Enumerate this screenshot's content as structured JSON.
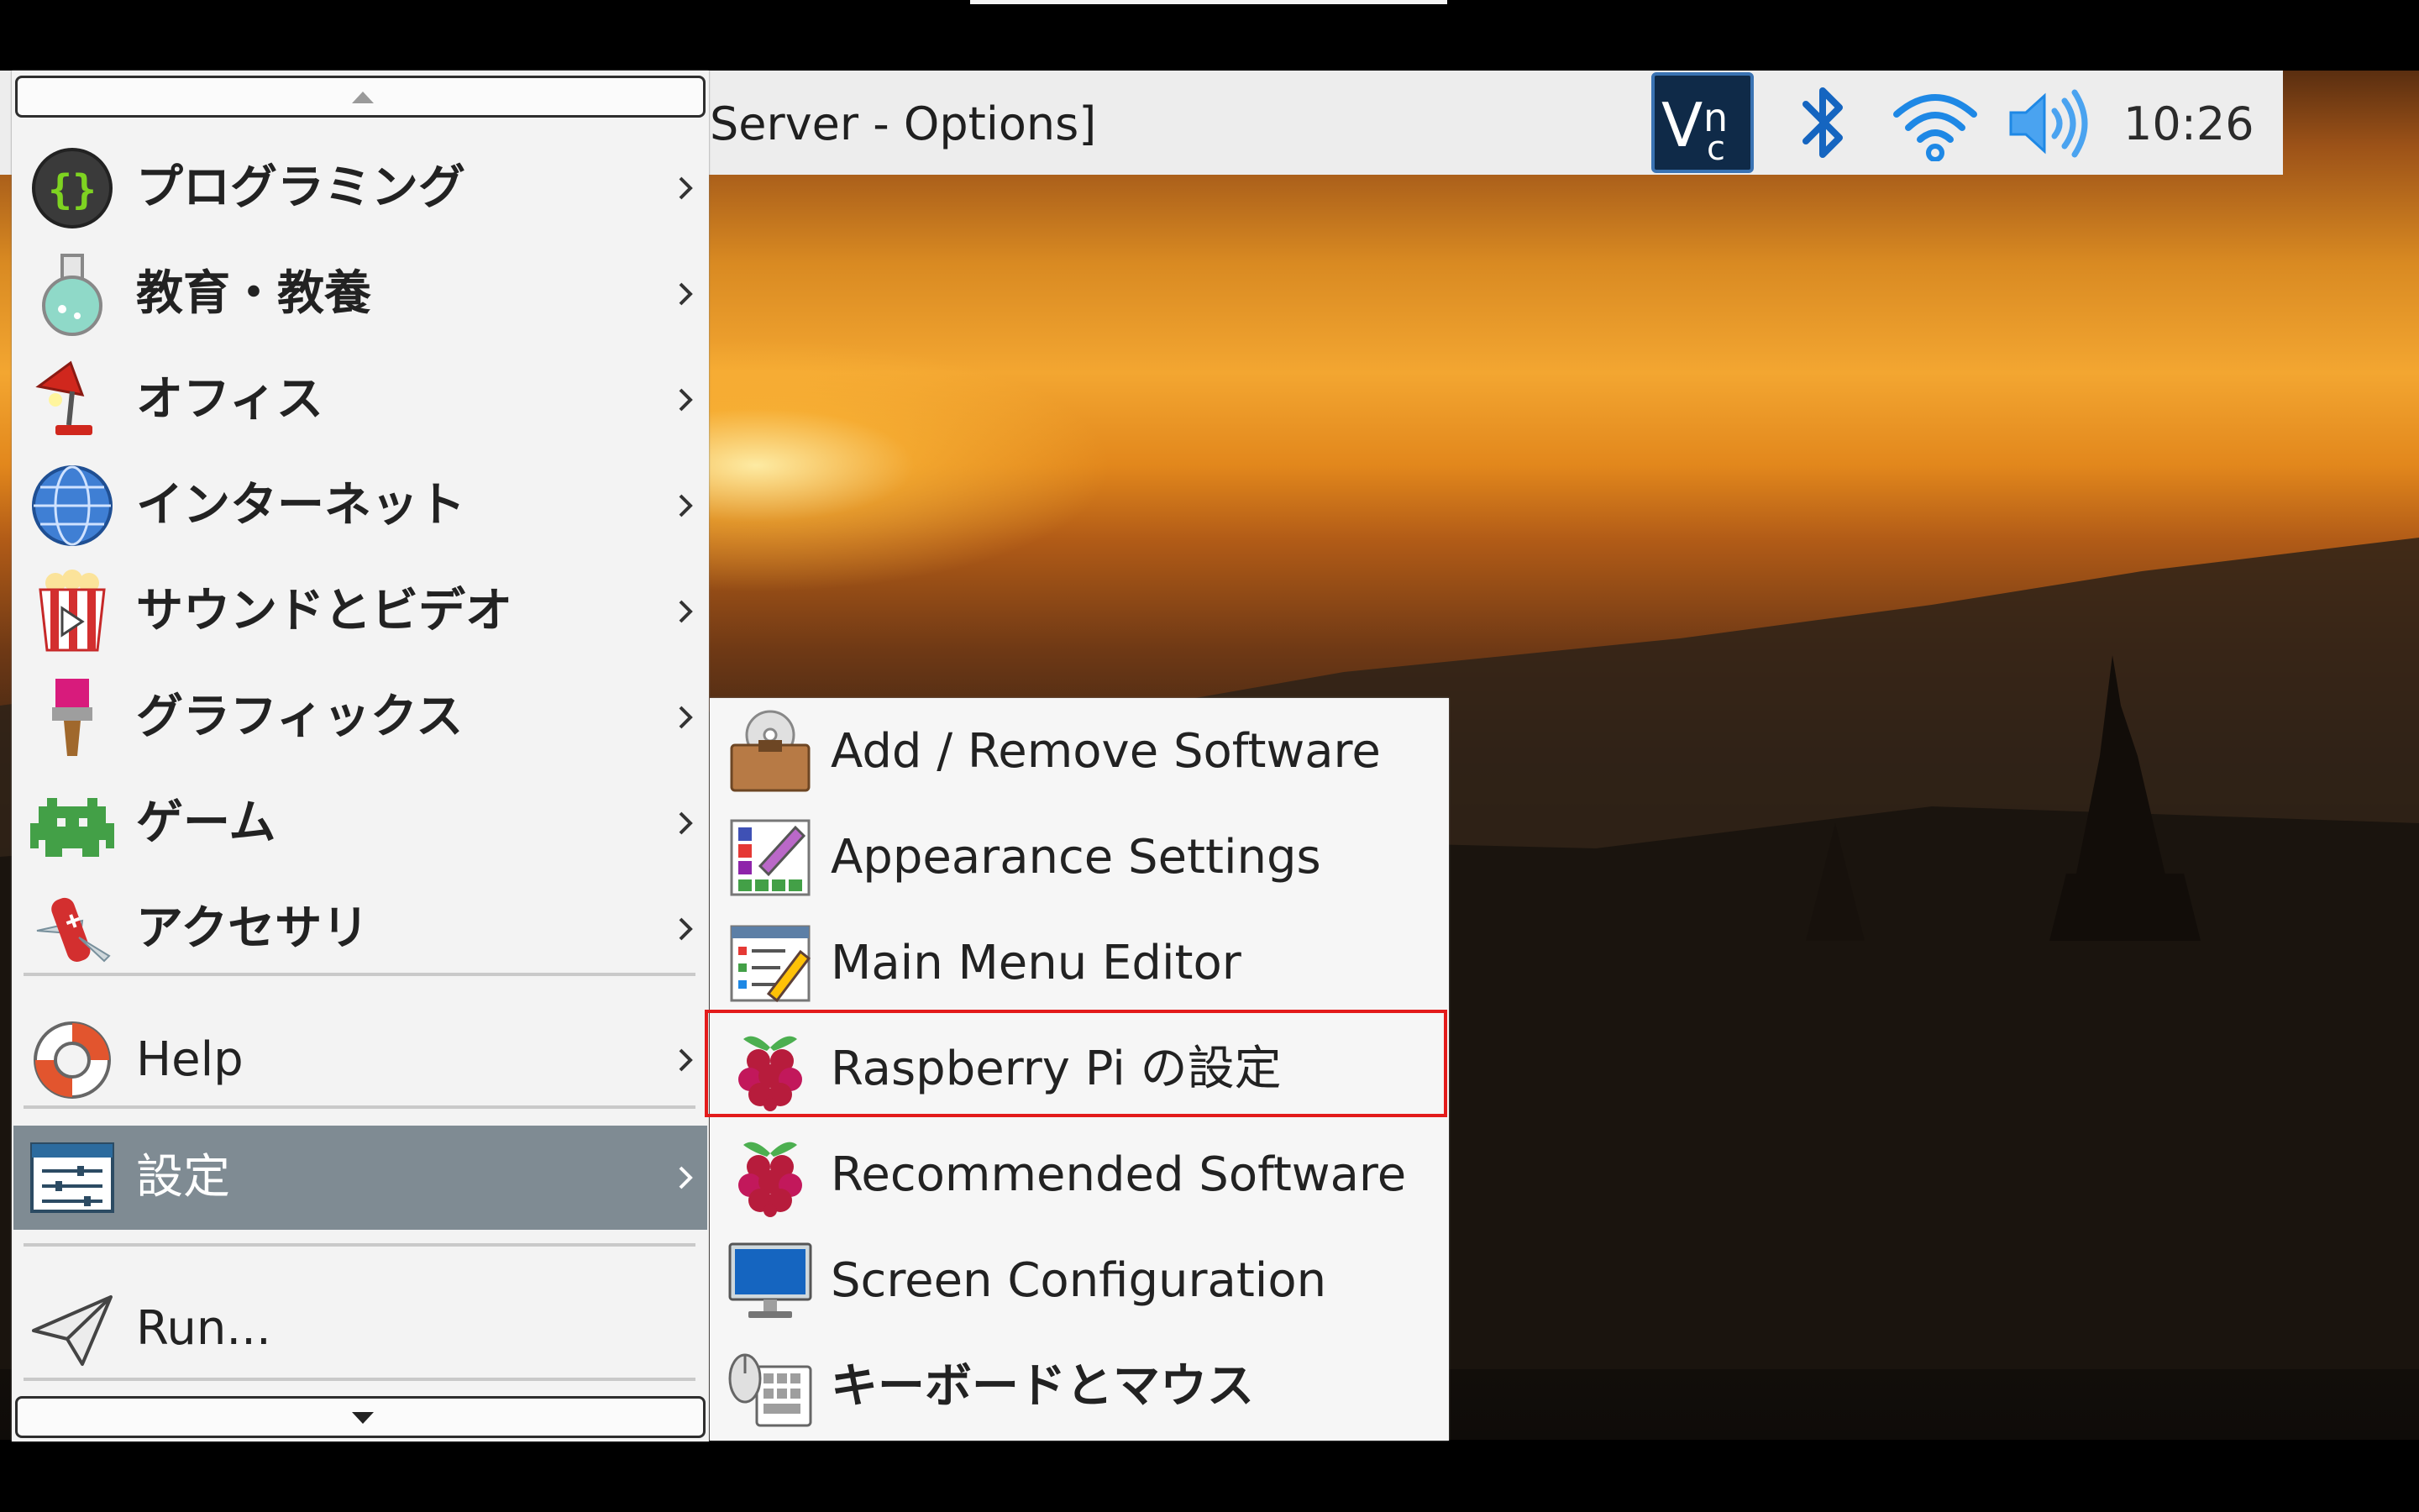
{
  "taskbar": {
    "window_title_fragment": "Server - Options]",
    "clock": "10:26",
    "tray_icons": [
      "vnc-icon",
      "bluetooth-icon",
      "wifi-icon",
      "volume-icon"
    ]
  },
  "main_menu": {
    "items": [
      {
        "label": "プログラミング",
        "icon": "programming-icon"
      },
      {
        "label": "教育・教養",
        "icon": "education-flask-icon"
      },
      {
        "label": "オフィス",
        "icon": "office-lamp-icon"
      },
      {
        "label": "インターネット",
        "icon": "globe-icon"
      },
      {
        "label": "サウンドとビデオ",
        "icon": "popcorn-video-icon"
      },
      {
        "label": "グラフィックス",
        "icon": "paintbrush-icon"
      },
      {
        "label": "ゲーム",
        "icon": "space-invader-icon"
      },
      {
        "label": "アクセサリ",
        "icon": "pocket-knife-icon"
      },
      {
        "label": "Help",
        "icon": "lifebuoy-icon"
      },
      {
        "label": "設定",
        "icon": "settings-sliders-icon",
        "selected": true
      },
      {
        "label": "Run...",
        "icon": "paper-plane-icon"
      }
    ]
  },
  "submenu": {
    "items": [
      {
        "label": "Add / Remove Software",
        "icon": "software-box-icon"
      },
      {
        "label": "Appearance Settings",
        "icon": "appearance-palette-icon"
      },
      {
        "label": "Main Menu Editor",
        "icon": "menu-editor-icon"
      },
      {
        "label": "Raspberry Pi の設定",
        "icon": "raspberry-icon",
        "highlighted": true
      },
      {
        "label": "Recommended Software",
        "icon": "raspberry-icon"
      },
      {
        "label": "Screen Configuration",
        "icon": "monitor-icon"
      },
      {
        "label": "キーボードとマウス",
        "icon": "keyboard-mouse-icon"
      }
    ]
  },
  "colors": {
    "selected_bg": "#7f8b93",
    "highlight_border": "#e31b1b",
    "menu_bg": "#f3f3f3",
    "taskbar_bg": "#ededed"
  }
}
